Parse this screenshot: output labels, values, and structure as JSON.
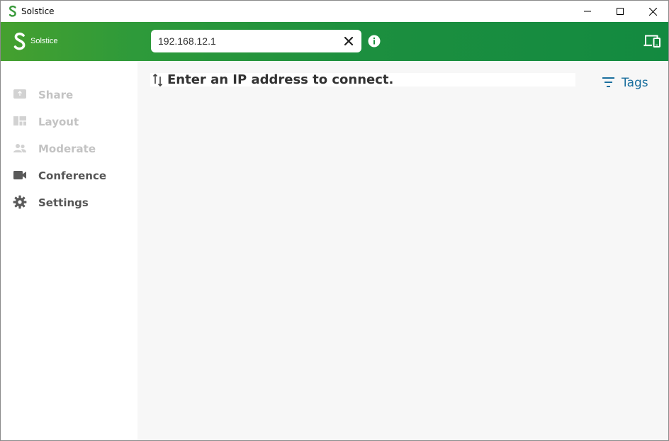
{
  "window": {
    "title": "Solstice",
    "controls": [
      "minimize",
      "maximize",
      "close"
    ]
  },
  "header": {
    "brand": "Solstice",
    "search": {
      "value": "192.168.12.1",
      "placeholder": ""
    },
    "icons": [
      "solstice-logo-icon",
      "clear-icon",
      "info-icon",
      "devices-icon"
    ],
    "gradient": [
      "#45a02f",
      "#138a40"
    ]
  },
  "sidebar": {
    "items": [
      {
        "label": "Share",
        "icon": "share-icon",
        "enabled": false
      },
      {
        "label": "Layout",
        "icon": "layout-icon",
        "enabled": false
      },
      {
        "label": "Moderate",
        "icon": "moderate-icon",
        "enabled": false
      },
      {
        "label": "Conference",
        "icon": "camera-icon",
        "enabled": true
      },
      {
        "label": "Settings",
        "icon": "gear-icon",
        "enabled": true
      }
    ]
  },
  "main": {
    "message": "Enter an IP address to connect.",
    "tags_label": "Tags"
  },
  "colors": {
    "accent_green": "#1c8f3f",
    "tags_blue": "#1b6f9e",
    "disabled_text": "#c3c3c3",
    "enabled_text": "#555555"
  }
}
